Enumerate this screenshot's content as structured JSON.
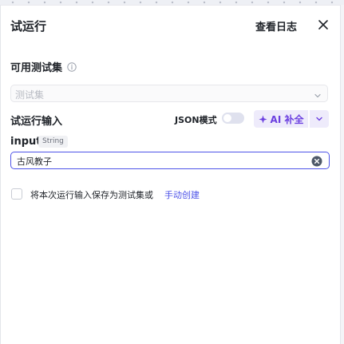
{
  "header": {
    "title": "试运行",
    "log_link": "查看日志"
  },
  "testset": {
    "label": "可用测试集",
    "placeholder": "测试集"
  },
  "run_input": {
    "label": "试运行输入",
    "json_mode_label": "JSON模式",
    "json_mode_on": false,
    "ai_fill_label": "AI 补全"
  },
  "param": {
    "name": "input",
    "type": "String",
    "value": "古风教子"
  },
  "save_option": {
    "text": "将本次运行输入保存为测试集或",
    "link": "手动创建",
    "checked": false
  },
  "colors": {
    "accent": "#4d53e8",
    "ai_purple": "#6b3fe0"
  }
}
